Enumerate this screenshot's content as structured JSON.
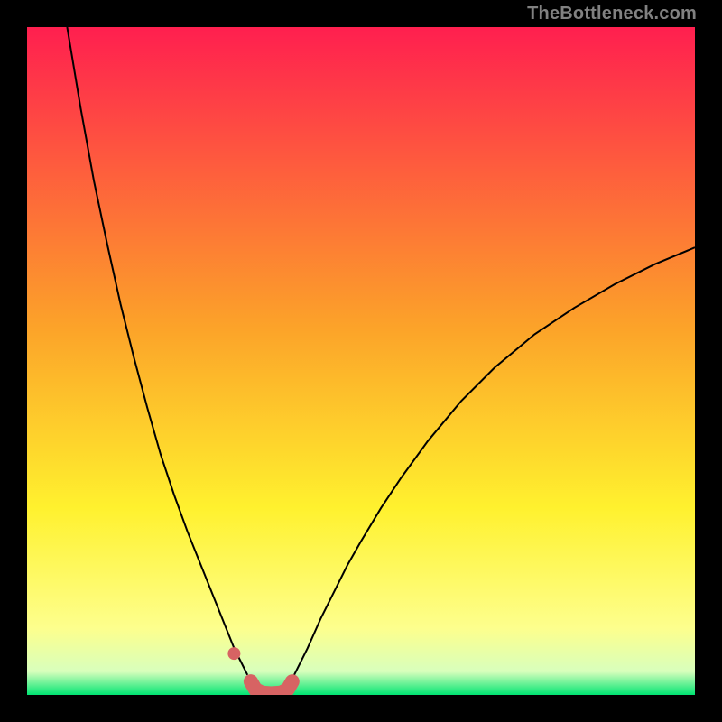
{
  "watermark": "TheBottleneck.com",
  "chart_data": {
    "type": "line",
    "title": "",
    "xlabel": "",
    "ylabel": "",
    "xlim": [
      0,
      100
    ],
    "ylim": [
      0,
      100
    ],
    "grid": false,
    "legend": false,
    "background_gradient": {
      "stops": [
        {
          "pos": 0.0,
          "color": "#ff1f4f"
        },
        {
          "pos": 0.45,
          "color": "#fca329"
        },
        {
          "pos": 0.72,
          "color": "#fff12e"
        },
        {
          "pos": 0.9,
          "color": "#fdff8d"
        },
        {
          "pos": 0.965,
          "color": "#d8ffbc"
        },
        {
          "pos": 1.0,
          "color": "#00e472"
        }
      ]
    },
    "series": [
      {
        "name": "left-curve",
        "stroke": "#000000",
        "stroke_width": 2,
        "x": [
          6.0,
          8.0,
          10.0,
          12.0,
          14.0,
          16.0,
          18.0,
          20.0,
          22.0,
          24.0,
          26.0,
          28.0,
          30.0,
          31.0,
          32.0,
          33.0
        ],
        "y": [
          100.0,
          88.0,
          77.0,
          67.5,
          58.5,
          50.5,
          43.0,
          36.0,
          30.0,
          24.5,
          19.5,
          14.5,
          9.5,
          7.0,
          5.0,
          3.0
        ]
      },
      {
        "name": "right-curve",
        "stroke": "#000000",
        "stroke_width": 2,
        "x": [
          40.0,
          42.0,
          44.0,
          46.0,
          48.0,
          50.0,
          53.0,
          56.0,
          60.0,
          65.0,
          70.0,
          76.0,
          82.0,
          88.0,
          94.0,
          100.0
        ],
        "y": [
          3.0,
          7.0,
          11.5,
          15.5,
          19.5,
          23.0,
          28.0,
          32.5,
          38.0,
          44.0,
          49.0,
          54.0,
          58.0,
          61.5,
          64.5,
          67.0
        ]
      },
      {
        "name": "bottom-connector",
        "stroke": "#d76363",
        "stroke_width": 16,
        "linecap": "round",
        "x": [
          33.5,
          34.2,
          35.2,
          36.5,
          38.0,
          39.0,
          39.7
        ],
        "y": [
          2.0,
          0.8,
          0.3,
          0.2,
          0.3,
          0.8,
          2.0
        ]
      }
    ],
    "markers": [
      {
        "name": "left-dot",
        "x": 31.0,
        "y": 6.2,
        "r": 7,
        "fill": "#d76363"
      }
    ]
  }
}
